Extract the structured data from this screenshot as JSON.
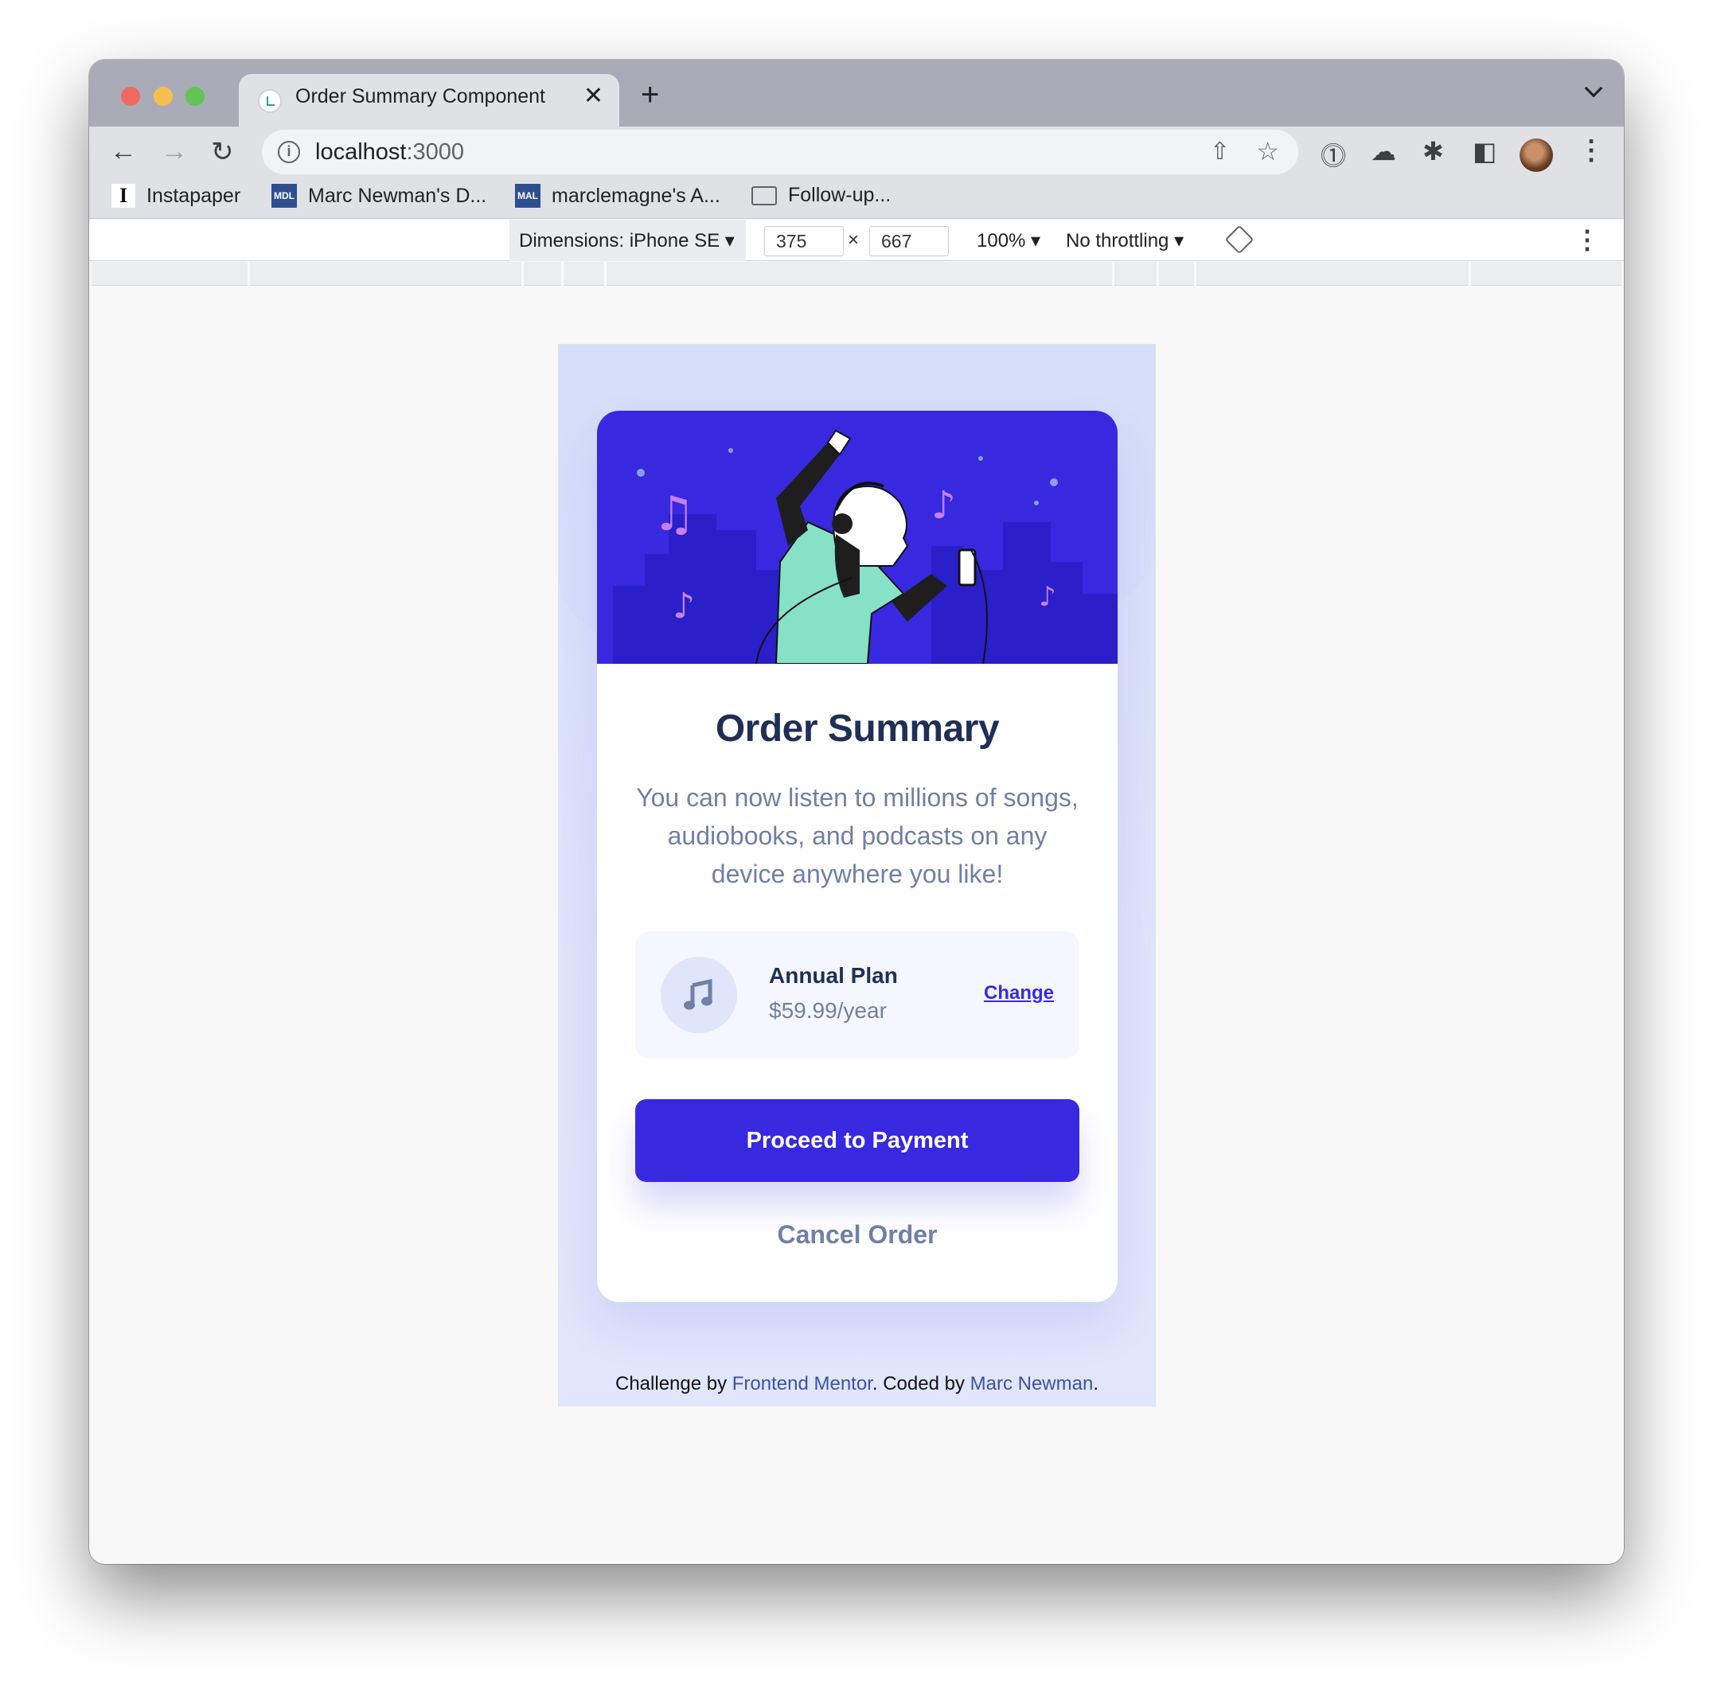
{
  "browser": {
    "tab_title": "Order Summary Component",
    "url_host": "localhost",
    "url_port": ":3000",
    "bookmarks": [
      {
        "label": "Instapaper",
        "icon": "I"
      },
      {
        "label": "Marc Newman's D...",
        "icon": "MDL"
      },
      {
        "label": "marclemagne's A...",
        "icon": "MAL"
      },
      {
        "label": "Follow-up...",
        "icon": "folder"
      }
    ]
  },
  "devtools": {
    "dimensions_label": "Dimensions: iPhone SE ▾",
    "width": "375",
    "height": "667",
    "separator": "×",
    "zoom": "100% ▾",
    "throttling": "No throttling ▾"
  },
  "card": {
    "title": "Order Summary",
    "description": "You can now listen to millions of songs, audiobooks, and podcasts on any device anywhere you like!",
    "plan": {
      "name": "Annual Plan",
      "price": "$59.99/year",
      "change_label": "Change"
    },
    "pay_label": "Proceed to Payment",
    "cancel_label": "Cancel Order"
  },
  "footer": {
    "prefix": "Challenge by ",
    "link1": "Frontend Mentor",
    "middle": ". Coded by ",
    "link2": "Marc Newman",
    "suffix": "."
  },
  "colors": {
    "accent": "#3829e0",
    "heading": "#1f2f56",
    "muted": "#717fa6",
    "plan_bg": "#f5f7ff"
  }
}
